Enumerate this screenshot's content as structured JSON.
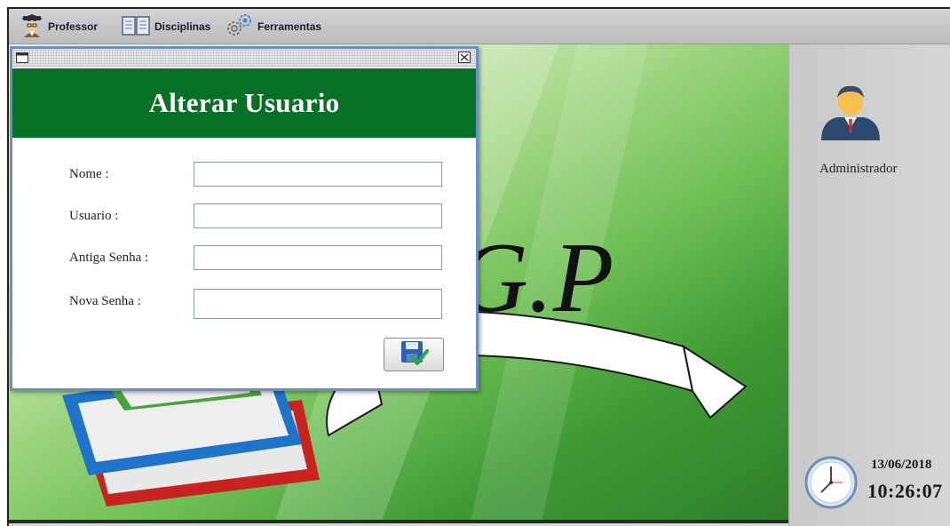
{
  "menubar": {
    "items": [
      {
        "label": "Professor",
        "icon": "professor-icon"
      },
      {
        "label": "Disciplinas",
        "icon": "book-icon"
      },
      {
        "label": "Ferramentas",
        "icon": "gears-icon"
      }
    ]
  },
  "background": {
    "logo_text": "S.G.P"
  },
  "sidepanel": {
    "user_role": "Administrador",
    "date": "13/06/2018",
    "time": "10:26:07",
    "icons": [
      "user-avatar-icon",
      "clock-icon"
    ]
  },
  "dialog": {
    "title": "Alterar Usuario",
    "titlebar_icons": [
      "window-menu-icon",
      "close-icon"
    ],
    "fields": [
      {
        "label": "Nome :",
        "value": ""
      },
      {
        "label": "Usuario :",
        "value": ""
      },
      {
        "label": "Antiga Senha :",
        "value": ""
      },
      {
        "label": "Nova Senha :",
        "value": ""
      }
    ],
    "save_icon": "save-disk-check-icon"
  },
  "colors": {
    "dialog_header": "#067024",
    "dialog_border": "#6e8fc4",
    "menubar": "#c8c8c8",
    "sidepanel": "#d0d0d0"
  }
}
